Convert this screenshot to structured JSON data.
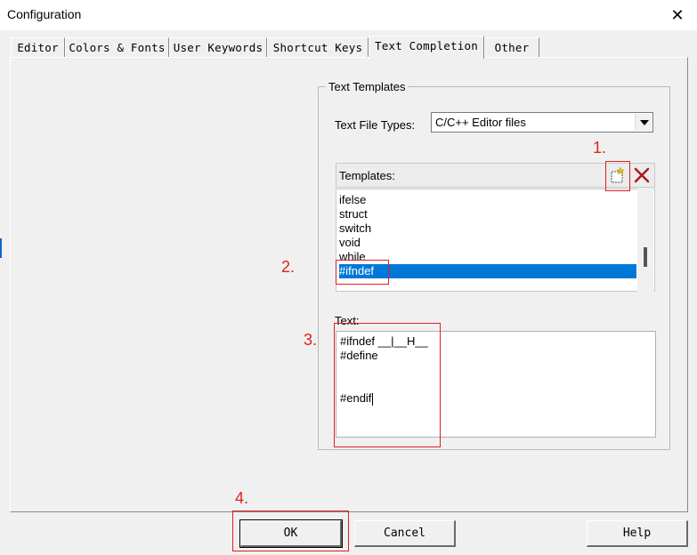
{
  "window": {
    "title": "Configuration",
    "close_glyph": "✕"
  },
  "tabs": [
    {
      "label": "Editor"
    },
    {
      "label": "Colors & Fonts"
    },
    {
      "label": "User Keywords"
    },
    {
      "label": "Shortcut Keys"
    },
    {
      "label": "Text Completion",
      "active": true
    },
    {
      "label": "Other"
    }
  ],
  "text_templates": {
    "group_label": "Text Templates",
    "file_types_label": "Text File Types:",
    "file_types_value": "C/C++ Editor files",
    "templates_label": "Templates:",
    "new_icon": "new-template-icon",
    "delete_icon": "delete-template-icon",
    "items": [
      "ifelse",
      "struct",
      "switch",
      "void",
      "while",
      "#ifndef"
    ],
    "selected": "#ifndef",
    "text_label": "Text:",
    "text_lines": [
      "#ifndef __|__H__",
      "#define",
      "",
      "",
      "#endif"
    ]
  },
  "buttons": {
    "ok": "OK",
    "cancel": "Cancel",
    "help": "Help"
  },
  "annotations": [
    "1.",
    "2.",
    "3.",
    "4."
  ],
  "colors": {
    "selection": "#0078d7",
    "annotation": "#e02020"
  }
}
